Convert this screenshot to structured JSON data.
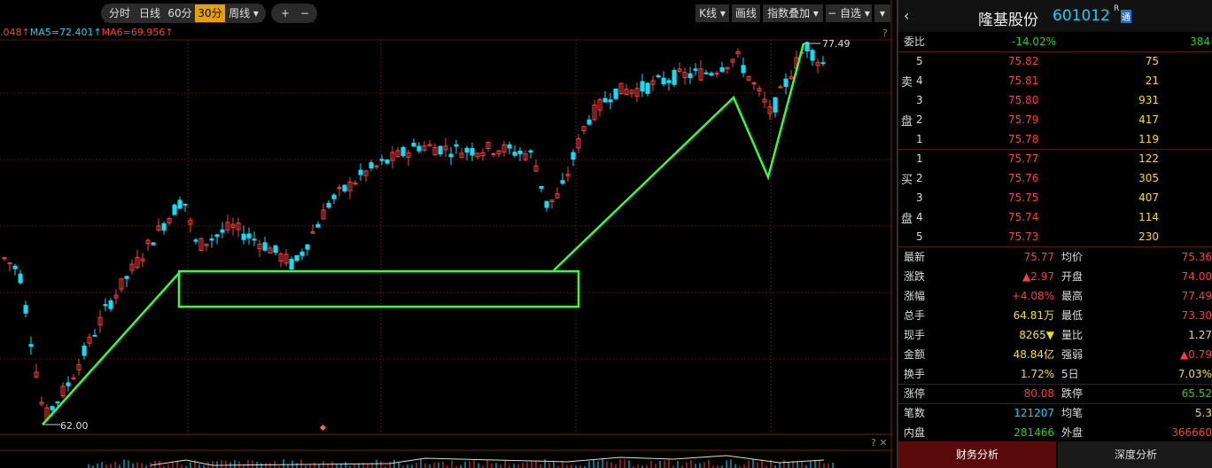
{
  "toolbar": {
    "periods": [
      "分时",
      "日线",
      "60分",
      "30分",
      "周线 ▾"
    ],
    "zoom_in": "+",
    "zoom_out": "−",
    "k_type": "K线 ▾",
    "draw": "画线",
    "index_overlay": "指数叠加 ▾",
    "watchlist": "− 自选 ▾",
    "more": "▾"
  },
  "ma": {
    "prefix": ".048↑",
    "ma5": "MA5=72.401↑",
    "ma6": "MA6=69.956↑"
  },
  "chart": {
    "help": "?",
    "bottom_icons": "? ✕",
    "low_label": "62.00",
    "high_label": "77.49",
    "colors": {
      "up": "#ff3b3b",
      "down": "#00e5ff",
      "trend": "#33ff33",
      "grid": "#5a1010"
    }
  },
  "stock": {
    "name": "隆基股份",
    "code": "601012",
    "badge_r": "R",
    "badge": "通"
  },
  "order_ratio": {
    "label": "委比",
    "pct": "-14.02%",
    "diff": "384"
  },
  "sell": {
    "side_top": "卖",
    "side_bottom": "盘",
    "levels": [
      {
        "n": "5",
        "price": "75.82",
        "vol": "75"
      },
      {
        "n": "4",
        "price": "75.81",
        "vol": "21"
      },
      {
        "n": "3",
        "price": "75.80",
        "vol": "931"
      },
      {
        "n": "2",
        "price": "75.79",
        "vol": "417"
      },
      {
        "n": "1",
        "price": "75.78",
        "vol": "119"
      }
    ]
  },
  "buy": {
    "side_top": "买",
    "side_bottom": "盘",
    "levels": [
      {
        "n": "1",
        "price": "75.77",
        "vol": "122"
      },
      {
        "n": "2",
        "price": "75.76",
        "vol": "305"
      },
      {
        "n": "3",
        "price": "75.75",
        "vol": "407"
      },
      {
        "n": "4",
        "price": "75.74",
        "vol": "114"
      },
      {
        "n": "5",
        "price": "75.73",
        "vol": "230"
      }
    ]
  },
  "stats": [
    {
      "l1": "最新",
      "v1": "75.77",
      "c1": "red",
      "l2": "均价",
      "v2": "75.36",
      "c2": "red"
    },
    {
      "l1": "涨跌",
      "v1": "▲2.97",
      "c1": "red",
      "l2": "开盘",
      "v2": "74.00",
      "c2": "red"
    },
    {
      "l1": "涨幅",
      "v1": "+4.08%",
      "c1": "red",
      "l2": "最高",
      "v2": "77.49",
      "c2": "red"
    },
    {
      "l1": "总手",
      "v1": "64.81万",
      "c1": "yellow",
      "l2": "最低",
      "v2": "73.30",
      "c2": "red"
    },
    {
      "l1": "现手",
      "v1": "8265▼",
      "c1": "yellow",
      "l2": "量比",
      "v2": "1.27",
      "c2": "yellow"
    },
    {
      "l1": "金额",
      "v1": "48.84亿",
      "c1": "yellow",
      "l2": "强弱",
      "v2": "▲0.79",
      "c2": "red"
    },
    {
      "l1": "换手",
      "v1": "1.72%",
      "c1": "yellow",
      "l2": "5日",
      "v2": "7.03%",
      "c2": "yellow"
    },
    {
      "l1": "涨停",
      "v1": "80.08",
      "c1": "red",
      "l2": "跌停",
      "v2": "65.52",
      "c2": "green"
    },
    {
      "l1": "笔数",
      "v1": "121207",
      "c1": "cyan",
      "l2": "均笔",
      "v2": "5.3",
      "c2": "yellow"
    },
    {
      "l1": "内盘",
      "v1": "281466",
      "c1": "green",
      "l2": "外盘",
      "v2": "366660",
      "c2": "red"
    }
  ],
  "tabs": [
    "财务分析",
    "深度分析"
  ]
}
